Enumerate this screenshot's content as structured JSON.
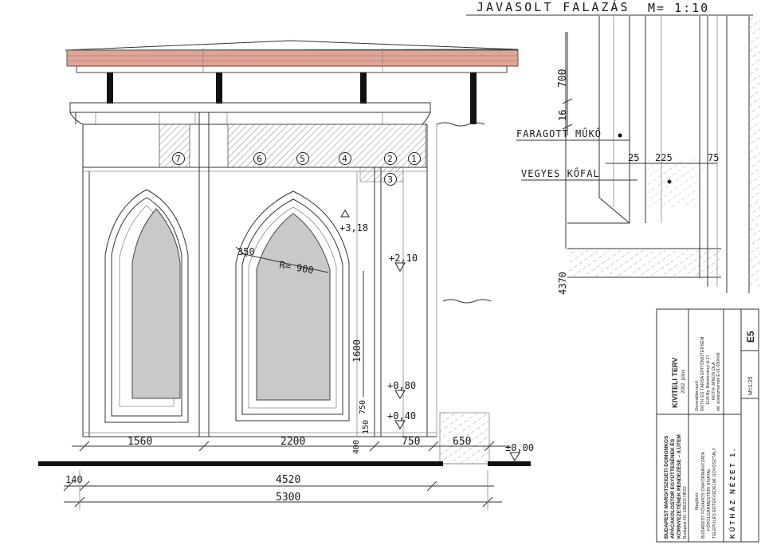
{
  "colors": {
    "cornice": "#e3a496",
    "glass": "#c9c9c9",
    "ground": "#111111",
    "ink": "#1a1a1a",
    "paper": "#ffffff"
  },
  "header": {
    "title": "JAVASOLT FALAZÁS",
    "scale": "M= 1:10"
  },
  "labels": {
    "faragott": "FARAGOTT MŰKŐ",
    "vegyes": "VEGYES KŐFAL",
    "detail_dims": [
      "25",
      "225",
      "75"
    ],
    "vertical_700": "700",
    "vertical_16": "16",
    "vertical_4370": "4370",
    "radius": "R= 900",
    "dim_350": "350"
  },
  "numbered_blocks": [
    "7",
    "6",
    "5",
    "4",
    "2",
    "1",
    "3"
  ],
  "levels": [
    {
      "label": "+3,18"
    },
    {
      "label": "+2,10"
    },
    {
      "label": "+0,80"
    },
    {
      "label": "+0,40"
    },
    {
      "label": "±0,00"
    }
  ],
  "dimensions": {
    "row1": [
      "1560",
      "2200",
      "750",
      "650"
    ],
    "small_vertical": [
      "750",
      "150",
      "400"
    ],
    "vertical_1600": "1600",
    "row2_total": "4520",
    "row3_total": "5300",
    "left_small": "140"
  },
  "title_block": {
    "project": [
      "BUDAPEST MARGITSZIGETI DOMONKOS",
      "APÁCAKOLOSTOR EGYÜTTESÉNEK ÉS",
      "KÖRNYEZETÉNEK RENDEZÉSE – II.ÜTEM",
      "Budapest XIII. 23802/2 HRSZ"
    ],
    "phase": "KIVITELI TERV",
    "date": "2002. július",
    "client_label": "Megbízó:",
    "client": [
      "BUDAPEST FŐVÁROS ÖNKORMÁNYZATA",
      "FŐPOLGÁRMESTERI HIVATAL",
      "TELEPÜLÉS ÉRTÉKVÉDELMI GOVOSZTÁLY"
    ],
    "designer_label": "Generáltervező:",
    "designer": [
      "ROTH ÉS TÁRSA ÉPÍTŐMŰTERSÉM",
      "1126 Bp. Böszörményi út 17.",
      "ROTH JÁNOS DLA",
      "okl. építészmérnök É-01-0304/06"
    ],
    "sheet_name": "KÚTHÁZ NÉZET 1.",
    "scale": "M=1:25",
    "sheet_no": "E5"
  }
}
